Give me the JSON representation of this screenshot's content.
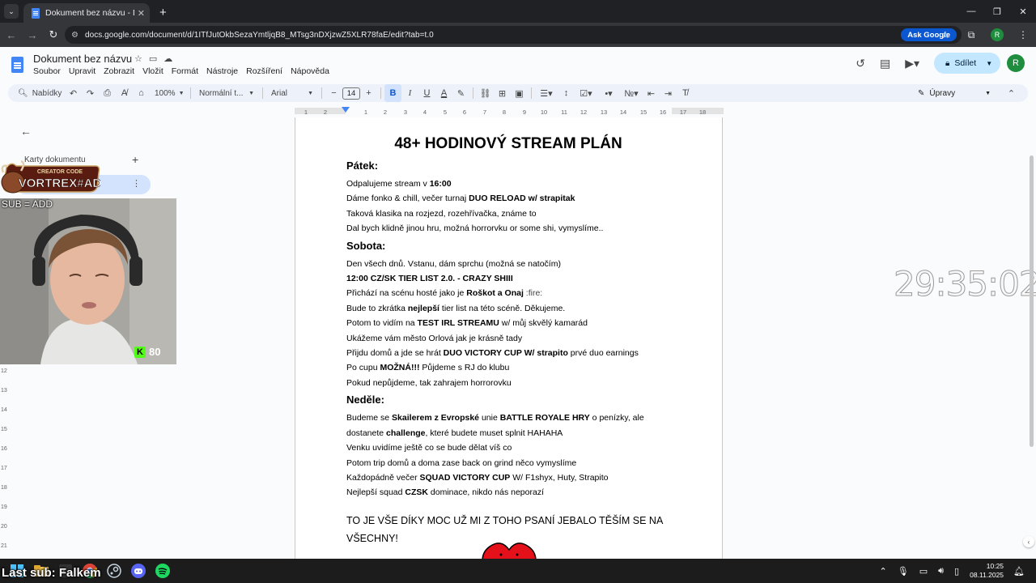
{
  "browser": {
    "tab_title": "Dokument bez názvu - Dokum",
    "url": "docs.google.com/document/d/1ITfJutOkbSezaYmtljqB8_MTsg3nDXjzwZ5XLR78faE/edit?tab=t.0",
    "ask_google": "Ask Google"
  },
  "docs": {
    "title": "Dokument bez názvu",
    "menus": [
      "Soubor",
      "Upravit",
      "Zobrazit",
      "Vložit",
      "Formát",
      "Nástroje",
      "Rozšíření",
      "Nápověda"
    ],
    "share_label": "Sdílet",
    "avatar_letter": "R",
    "toolbar": {
      "search": "Nabídky",
      "zoom": "100%",
      "style": "Normální t...",
      "font": "Arial",
      "size": "14",
      "mode": "Úpravy"
    },
    "ruler_ticks": [
      "1",
      "2",
      "1",
      "2",
      "3",
      "4",
      "5",
      "6",
      "7",
      "8",
      "9",
      "10",
      "11",
      "12",
      "13",
      "14",
      "15",
      "16",
      "17",
      "18"
    ],
    "vruler_ticks": [
      "12",
      "13",
      "14",
      "15",
      "16",
      "17",
      "18",
      "19",
      "20",
      "21"
    ]
  },
  "sidebar": {
    "tabs_label": "Karty dokumentu"
  },
  "overlay": {
    "creator_code_top": "CREATOR CODE",
    "creator_code_name": "VORTREX#AD",
    "sub_add": "SUB = ADD",
    "kick_count": "80",
    "timer": "29:35:02",
    "last_sub": "Last sub: Falkem"
  },
  "document": {
    "heading": "48+ HODINOVÝ STREAM PLÁN",
    "friday_title": "Pátek:",
    "friday": {
      "l1a": "Odpalujeme stream v ",
      "l1b": "16:00",
      "l2a": "Dáme fonko & chill, večer turnaj ",
      "l2b": "DUO RELOAD w/ strapitak",
      "l3": "Taková klasika na rozjezd, rozehřívačka, známe to",
      "l4": "Dal bych klidně jinou hru, možná horrorvku or some shi, vymyslíme.."
    },
    "saturday_title": "Sobota:",
    "saturday": {
      "l1": "Den všech dnů. Vstanu, dám sprchu (možná se natočím)",
      "l2": "12:00 CZ/SK TIER LIST 2.0. - CRAZY SHIII",
      "l3a": "Přichází na scénu hosté jako je ",
      "l3b": "Roškot a Onaj",
      "l3c": " :fire:",
      "l4a": "Bude to zkrátka ",
      "l4b": "nejlepší",
      "l4c": " tier list na této scéně. Děkujeme.",
      "l5a": "Potom to vidím na ",
      "l5b": "TEST IRL STREAMU",
      "l5c": " w/ můj skvělý kamarád",
      "l6": "Ukážeme vám město Orlová jak je krásně tady",
      "l7a": "Přijdu domů a jde se hrát ",
      "l7b": "DUO VICTORY CUP W/ strapito",
      "l7c": " prvé duo earnings",
      "l8a": "Po cupu ",
      "l8b": "MOŽNÁ!!!",
      "l8c": " Půjdeme s RJ do klubu",
      "l9": "Pokud nepůjdeme, tak zahrajem horrorovku"
    },
    "sunday_title": "Neděle:",
    "sunday": {
      "l1a": "Budeme se ",
      "l1b": "Skailerem z Evropské",
      "l1c": " unie ",
      "l1d": "BATTLE ROYALE HRY",
      "l1e": " o penízky, ale",
      "l2a": "dostanete ",
      "l2b": "challenge",
      "l2c": ", které budete muset splnit HAHAHA",
      "l3": "Venku uvidíme ještě co se bude dělat víš co",
      "l4": "Potom trip domů a doma zase back on grind něco vymyslíme",
      "l5a": "Každopádně večer ",
      "l5b": "SQUAD VICTORY CUP",
      "l5c": " W/ F1shyx, Huty, Strapito",
      "l6a": "Nejlepší squad ",
      "l6b": "CZSK",
      "l6c": " dominace, nikdo nás neporazí"
    },
    "closing_l1": "TO JE VŠE DÍKY MOC UŽ MI Z TOHO PSANÍ JEBALO TĚŠÍM SE NA",
    "closing_l2": "VŠECHNY!"
  },
  "taskbar": {
    "time": "10:25",
    "date": "08.11.2025"
  },
  "colors": {
    "chrome_dark": "#202124",
    "accent_blue": "#0b57d0",
    "share_bg": "#c2e7ff",
    "kick_green": "#53fc18"
  }
}
